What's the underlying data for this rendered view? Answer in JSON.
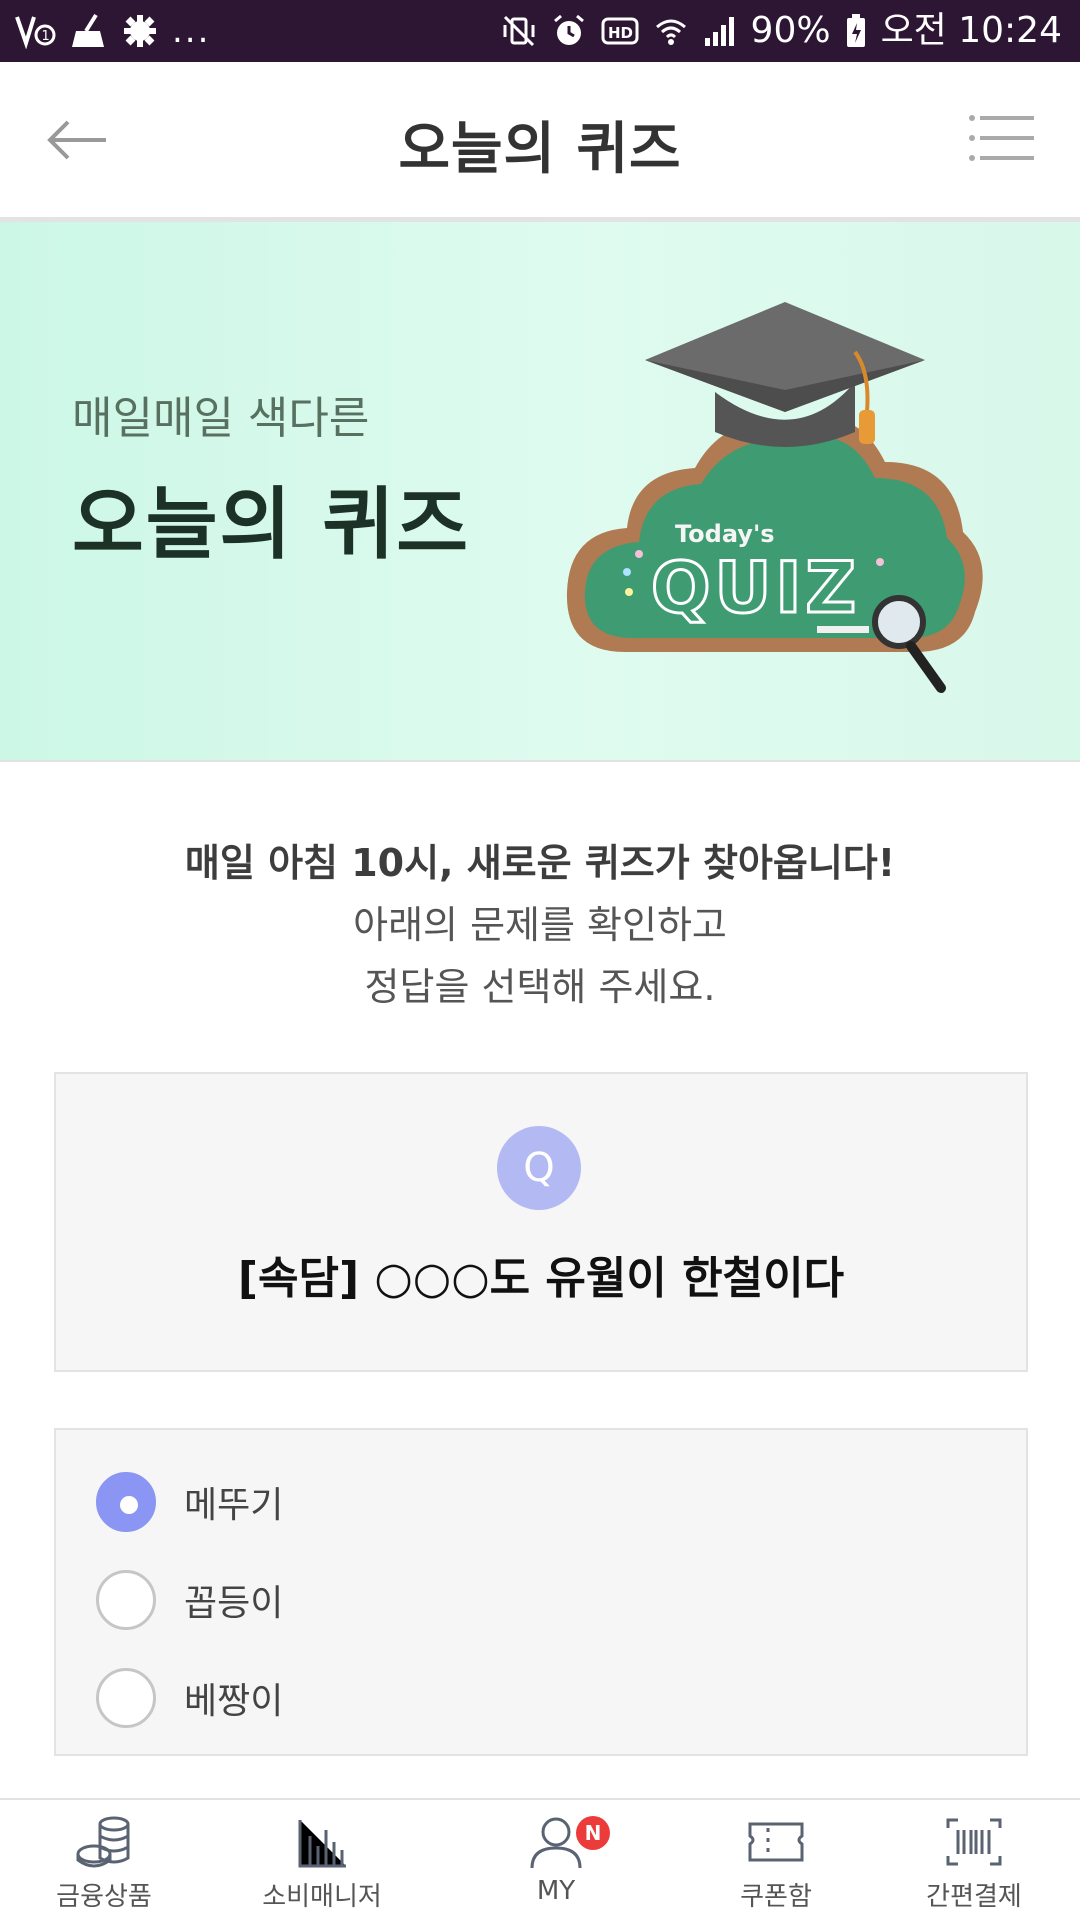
{
  "status_bar": {
    "left_icons": [
      "volte-icon",
      "broom-icon",
      "settings-gear-icon"
    ],
    "more": "...",
    "right_icons": [
      "vibrate-off-icon",
      "alarm-icon",
      "hd-icon",
      "wifi-icon",
      "signal-icon"
    ],
    "battery": "90%",
    "time": "오전 10:24"
  },
  "header": {
    "title": "오늘의 퀴즈",
    "back_icon": "back-arrow-icon",
    "menu_icon": "menu-icon"
  },
  "banner": {
    "subtitle": "매일매일 색다른",
    "title": "오늘의 퀴즈",
    "art_small_text": "Today's",
    "art_big_text": "QUIZ"
  },
  "intro": {
    "line1": "매일 아침 10시, 새로운 퀴즈가 찾아옵니다!",
    "line2": "아래의 문제를 확인하고",
    "line3": "정답을 선택해 주세요."
  },
  "question": {
    "badge": "Q",
    "text": "[속담] ○○○도 유월이 한철이다"
  },
  "options": [
    {
      "label": "메뚜기",
      "selected": true
    },
    {
      "label": "꼽등이",
      "selected": false
    },
    {
      "label": "베짱이",
      "selected": false
    }
  ],
  "bottom_nav": [
    {
      "label": "금융상품",
      "icon": "coins-icon"
    },
    {
      "label": "소비매니저",
      "icon": "bar-chart-icon"
    },
    {
      "label": "MY",
      "icon": "user-icon",
      "badge": "N"
    },
    {
      "label": "쿠폰함",
      "icon": "coupon-icon"
    },
    {
      "label": "간편결제",
      "icon": "barcode-icon"
    }
  ],
  "colors": {
    "status_bar": "#2d1633",
    "accent": "#8b95f4",
    "q_badge": "#b3b9f3",
    "badge": "#ec3b3b"
  }
}
